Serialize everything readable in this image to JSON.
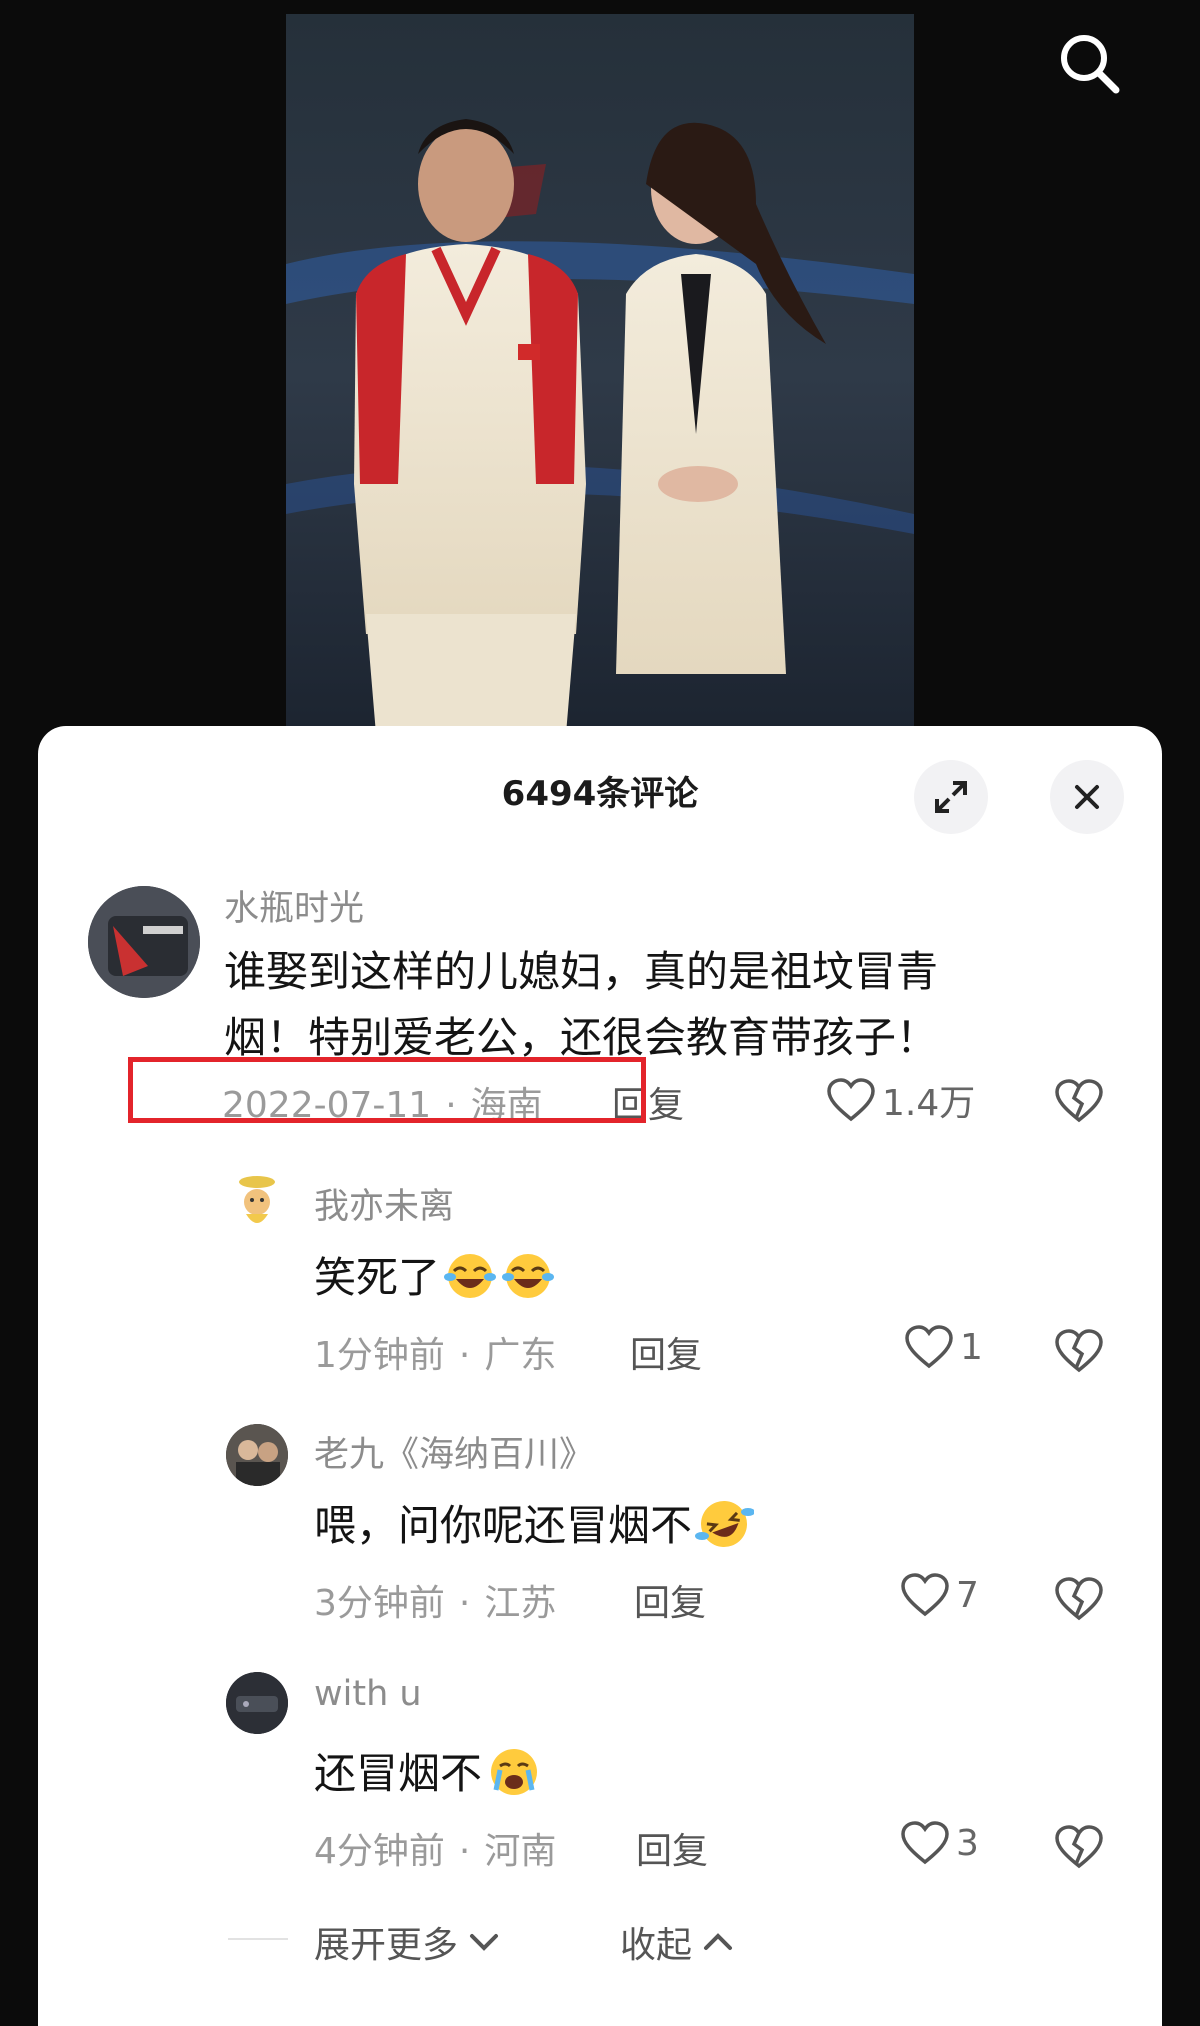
{
  "header": {
    "search_icon": "search-icon"
  },
  "sheet": {
    "title": "6494条评论",
    "expand_icon": "expand-icon",
    "close_icon": "close-icon"
  },
  "comments": [
    {
      "username": "水瓶时光",
      "lines": [
        "谁娶到这样的儿媳妇，真的是祖坟冒青",
        "烟！特别爱老公，还很会教育带孩子！"
      ],
      "date": "2022-07-11",
      "location": "海南",
      "reply_label": "回复",
      "likes": "1.4万"
    }
  ],
  "replies": [
    {
      "username": "我亦未离",
      "text": "笑死了",
      "emoji": [
        "laughing-tears-emoji",
        "laughing-tears-emoji"
      ],
      "time": "1分钟前",
      "location": "广东",
      "reply_label": "回复",
      "likes": "1"
    },
    {
      "username": "老九《海纳百川》",
      "text": "喂，问你呢还冒烟不",
      "emoji": [
        "rolling-laughing-emoji"
      ],
      "time": "3分钟前",
      "location": "江苏",
      "reply_label": "回复",
      "likes": "7"
    },
    {
      "username": "with u",
      "text": "还冒烟不",
      "emoji": [
        "crying-emoji"
      ],
      "time": "4分钟前",
      "location": "河南",
      "reply_label": "回复",
      "likes": "3"
    }
  ],
  "footer": {
    "expand_more": "展开更多",
    "collapse": "收起"
  },
  "colors": {
    "highlight_border": "#e3242b",
    "sheet_bg": "#ffffff",
    "muted_text": "#9a9a9a"
  }
}
